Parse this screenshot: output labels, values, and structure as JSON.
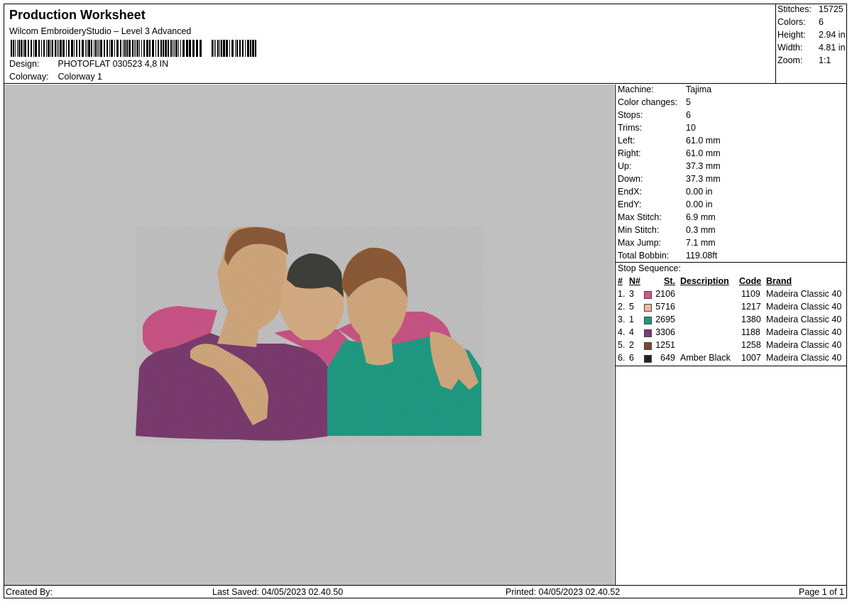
{
  "header": {
    "title": "Production Worksheet",
    "software": "Wilcom EmbroideryStudio – Level 3 Advanced",
    "design_label": "Design:",
    "design_value": "PHOTOFLAT 030523 4,8 IN",
    "colorway_label": "Colorway:",
    "colorway_value": "Colorway 1"
  },
  "stats": [
    {
      "label": "Stitches:",
      "value": "15725"
    },
    {
      "label": "Colors:",
      "value": "6"
    },
    {
      "label": "Height:",
      "value": "2.94 in"
    },
    {
      "label": "Width:",
      "value": "4.81 in"
    },
    {
      "label": "Zoom:",
      "value": "1:1"
    }
  ],
  "machine_props": [
    {
      "label": "Machine:",
      "value": "Tajima"
    },
    {
      "label": "Color changes:",
      "value": "5"
    },
    {
      "label": "Stops:",
      "value": "6"
    },
    {
      "label": "Trims:",
      "value": "10"
    },
    {
      "label": "Left:",
      "value": "61.0 mm"
    },
    {
      "label": "Right:",
      "value": "61.0 mm"
    },
    {
      "label": "Up:",
      "value": "37.3 mm"
    },
    {
      "label": "Down:",
      "value": "37.3 mm"
    },
    {
      "label": "EndX:",
      "value": "0.00 in"
    },
    {
      "label": "EndY:",
      "value": "0.00 in"
    },
    {
      "label": "Max Stitch:",
      "value": "6.9 mm"
    },
    {
      "label": "Min Stitch:",
      "value": "0.3 mm"
    },
    {
      "label": "Max Jump:",
      "value": "7.1 mm"
    },
    {
      "label": "Total Bobbin:",
      "value": "119.08ft"
    }
  ],
  "stop_sequence": {
    "title": "Stop Sequence:",
    "headers": {
      "num": "#",
      "n": "N#",
      "st": "St.",
      "description": "Description",
      "code": "Code",
      "brand": "Brand"
    },
    "rows": [
      {
        "num": "1.",
        "n": "3",
        "color": "#d4578a",
        "st": "2106",
        "description": "",
        "code": "1109",
        "brand": "Madeira Classic 40"
      },
      {
        "num": "2.",
        "n": "5",
        "color": "#f0b89a",
        "st": "5716",
        "description": "",
        "code": "1217",
        "brand": "Madeira Classic 40"
      },
      {
        "num": "3.",
        "n": "1",
        "color": "#1a9a86",
        "st": "2695",
        "description": "",
        "code": "1380",
        "brand": "Madeira Classic 40"
      },
      {
        "num": "4.",
        "n": "4",
        "color": "#7a3a78",
        "st": "3306",
        "description": "",
        "code": "1188",
        "brand": "Madeira Classic 40"
      },
      {
        "num": "5.",
        "n": "2",
        "color": "#7a4a2a",
        "st": "1251",
        "description": "",
        "code": "1258",
        "brand": "Madeira Classic 40"
      },
      {
        "num": "6.",
        "n": "6",
        "color": "#222222",
        "st": "649",
        "description": "Amber Black",
        "code": "1007",
        "brand": "Madeira Classic 40"
      }
    ]
  },
  "footer": {
    "created_by": "Created By:",
    "last_saved": "Last Saved: 04/05/2023 02.40.50",
    "printed": "Printed: 04/05/2023 02.40.52",
    "page": "Page 1 of 1"
  }
}
